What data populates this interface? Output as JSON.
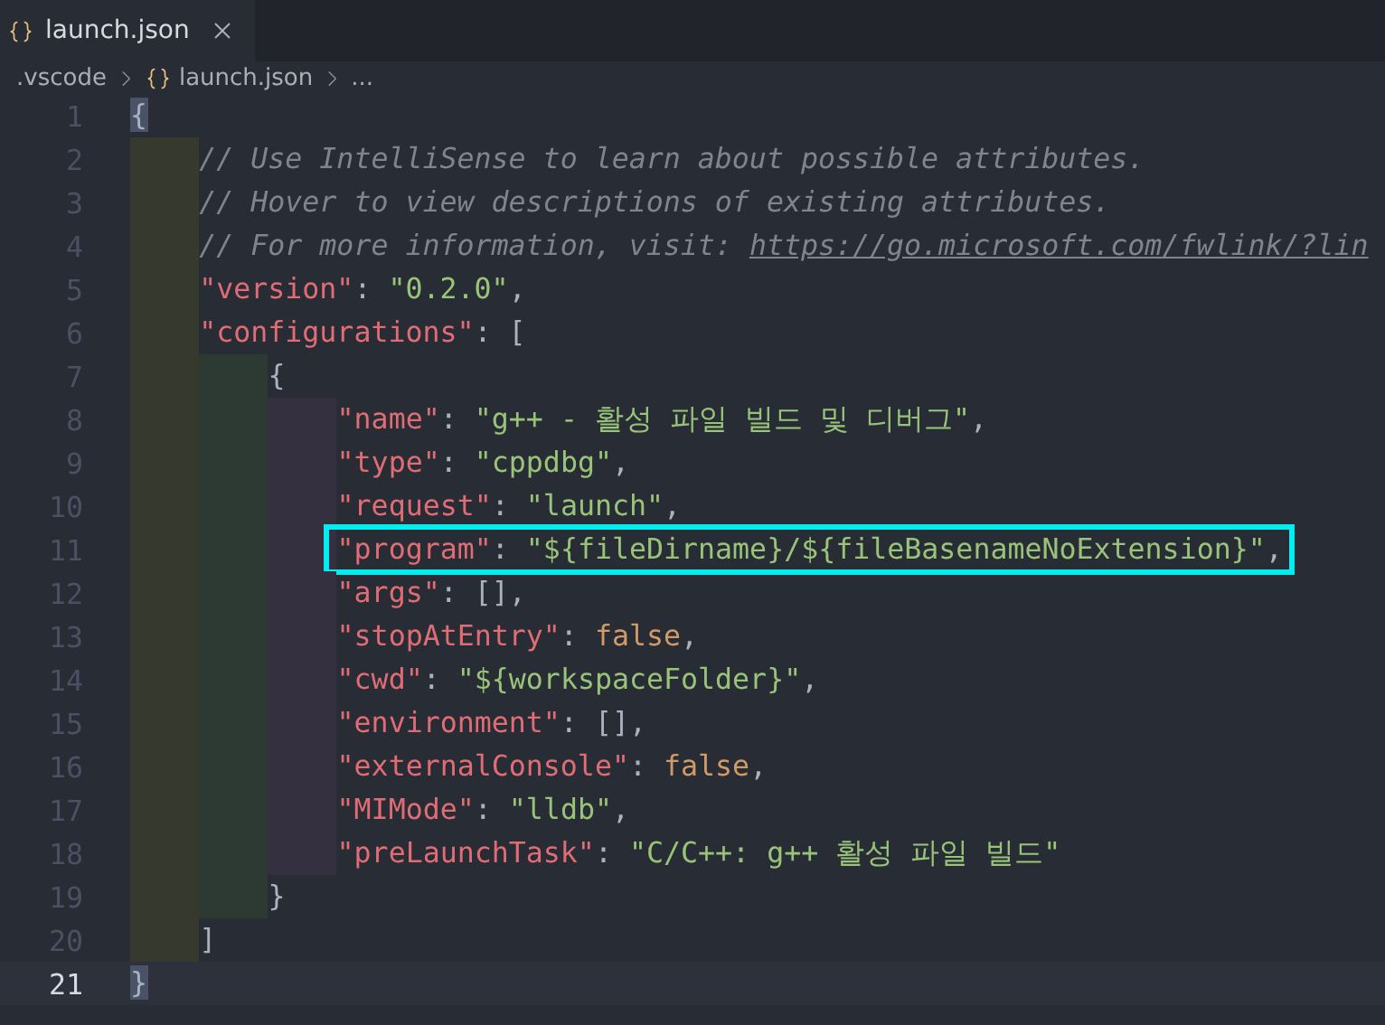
{
  "tabs": [
    {
      "label": "launch.json",
      "selected": true
    }
  ],
  "breadcrumb": [
    {
      "label": ".vscode",
      "kind": "folder"
    },
    {
      "label": "launch.json",
      "kind": "json"
    },
    {
      "label": "...",
      "kind": "more"
    }
  ],
  "lines": [
    {
      "number": "1",
      "tokens": [
        {
          "kind": "bracket",
          "text": "{"
        }
      ],
      "children": [
        {
          "number": "2",
          "tokens": [
            {
              "kind": "comment",
              "text": "// Use IntelliSense to learn about possible attributes."
            }
          ]
        },
        {
          "number": "3",
          "tokens": [
            {
              "kind": "comment",
              "text": "// Hover to view descriptions of existing attributes."
            }
          ]
        },
        {
          "number": "4",
          "tokens": [
            {
              "kind": "comment",
              "text": "// For more information, visit: "
            },
            {
              "kind": "link",
              "text": "https://go.microsoft.com/fwlink/?lin"
            }
          ]
        },
        {
          "number": "5",
          "tokens": [
            {
              "kind": "key",
              "text": "\"version\""
            },
            {
              "kind": "punct",
              "text": ": "
            },
            {
              "kind": "string",
              "text": "\"0.2.0\""
            },
            {
              "kind": "punct",
              "text": ","
            }
          ]
        },
        {
          "number": "6",
          "tokens": [
            {
              "kind": "key",
              "text": "\"configurations\""
            },
            {
              "kind": "punct",
              "text": ": ["
            }
          ],
          "children": [
            {
              "number": "7",
              "tokens": [
                {
                  "kind": "punct",
                  "text": "{"
                }
              ],
              "children": [
                {
                  "number": "8",
                  "tokens": [
                    {
                      "kind": "key",
                      "text": "\"name\""
                    },
                    {
                      "kind": "punct",
                      "text": ": "
                    },
                    {
                      "kind": "string",
                      "text": "\"g++ - 활성 파일 빌드 및 디버그\""
                    },
                    {
                      "kind": "punct",
                      "text": ","
                    }
                  ]
                },
                {
                  "number": "9",
                  "tokens": [
                    {
                      "kind": "key",
                      "text": "\"type\""
                    },
                    {
                      "kind": "punct",
                      "text": ": "
                    },
                    {
                      "kind": "string",
                      "text": "\"cppdbg\""
                    },
                    {
                      "kind": "punct",
                      "text": ","
                    }
                  ]
                },
                {
                  "number": "10",
                  "tokens": [
                    {
                      "kind": "key",
                      "text": "\"request\""
                    },
                    {
                      "kind": "punct",
                      "text": ": "
                    },
                    {
                      "kind": "string",
                      "text": "\"launch\""
                    },
                    {
                      "kind": "punct",
                      "text": ","
                    }
                  ]
                },
                {
                  "number": "11",
                  "highlighted": true,
                  "tokens": [
                    {
                      "kind": "key",
                      "text": "\"program\""
                    },
                    {
                      "kind": "punct",
                      "text": ": "
                    },
                    {
                      "kind": "string",
                      "text": "\"${fileDirname}/${fileBasenameNoExtension}\""
                    },
                    {
                      "kind": "punct",
                      "text": ","
                    }
                  ]
                },
                {
                  "number": "12",
                  "tokens": [
                    {
                      "kind": "key",
                      "text": "\"args\""
                    },
                    {
                      "kind": "punct",
                      "text": ": [],"
                    }
                  ]
                },
                {
                  "number": "13",
                  "tokens": [
                    {
                      "kind": "key",
                      "text": "\"stopAtEntry\""
                    },
                    {
                      "kind": "punct",
                      "text": ": "
                    },
                    {
                      "kind": "keyword",
                      "text": "false"
                    },
                    {
                      "kind": "punct",
                      "text": ","
                    }
                  ]
                },
                {
                  "number": "14",
                  "tokens": [
                    {
                      "kind": "key",
                      "text": "\"cwd\""
                    },
                    {
                      "kind": "punct",
                      "text": ": "
                    },
                    {
                      "kind": "string",
                      "text": "\"${workspaceFolder}\""
                    },
                    {
                      "kind": "punct",
                      "text": ","
                    }
                  ]
                },
                {
                  "number": "15",
                  "tokens": [
                    {
                      "kind": "key",
                      "text": "\"environment\""
                    },
                    {
                      "kind": "punct",
                      "text": ": [],"
                    }
                  ]
                },
                {
                  "number": "16",
                  "tokens": [
                    {
                      "kind": "key",
                      "text": "\"externalConsole\""
                    },
                    {
                      "kind": "punct",
                      "text": ": "
                    },
                    {
                      "kind": "keyword",
                      "text": "false"
                    },
                    {
                      "kind": "punct",
                      "text": ","
                    }
                  ]
                },
                {
                  "number": "17",
                  "tokens": [
                    {
                      "kind": "key",
                      "text": "\"MIMode\""
                    },
                    {
                      "kind": "punct",
                      "text": ": "
                    },
                    {
                      "kind": "string",
                      "text": "\"lldb\""
                    },
                    {
                      "kind": "punct",
                      "text": ","
                    }
                  ]
                },
                {
                  "number": "18",
                  "tokens": [
                    {
                      "kind": "key",
                      "text": "\"preLaunchTask\""
                    },
                    {
                      "kind": "punct",
                      "text": ": "
                    },
                    {
                      "kind": "string",
                      "text": "\"C/C++: g++ 활성 파일 빌드\""
                    }
                  ]
                }
              ]
            },
            {
              "number": "19",
              "tokens": [
                {
                  "kind": "punct",
                  "text": "}"
                }
              ]
            }
          ]
        },
        {
          "number": "20",
          "tokens": [
            {
              "kind": "punct",
              "text": "]"
            }
          ]
        }
      ]
    },
    {
      "number": "21",
      "current": true,
      "tokens": [
        {
          "kind": "bracket",
          "text": "}"
        }
      ]
    }
  ]
}
